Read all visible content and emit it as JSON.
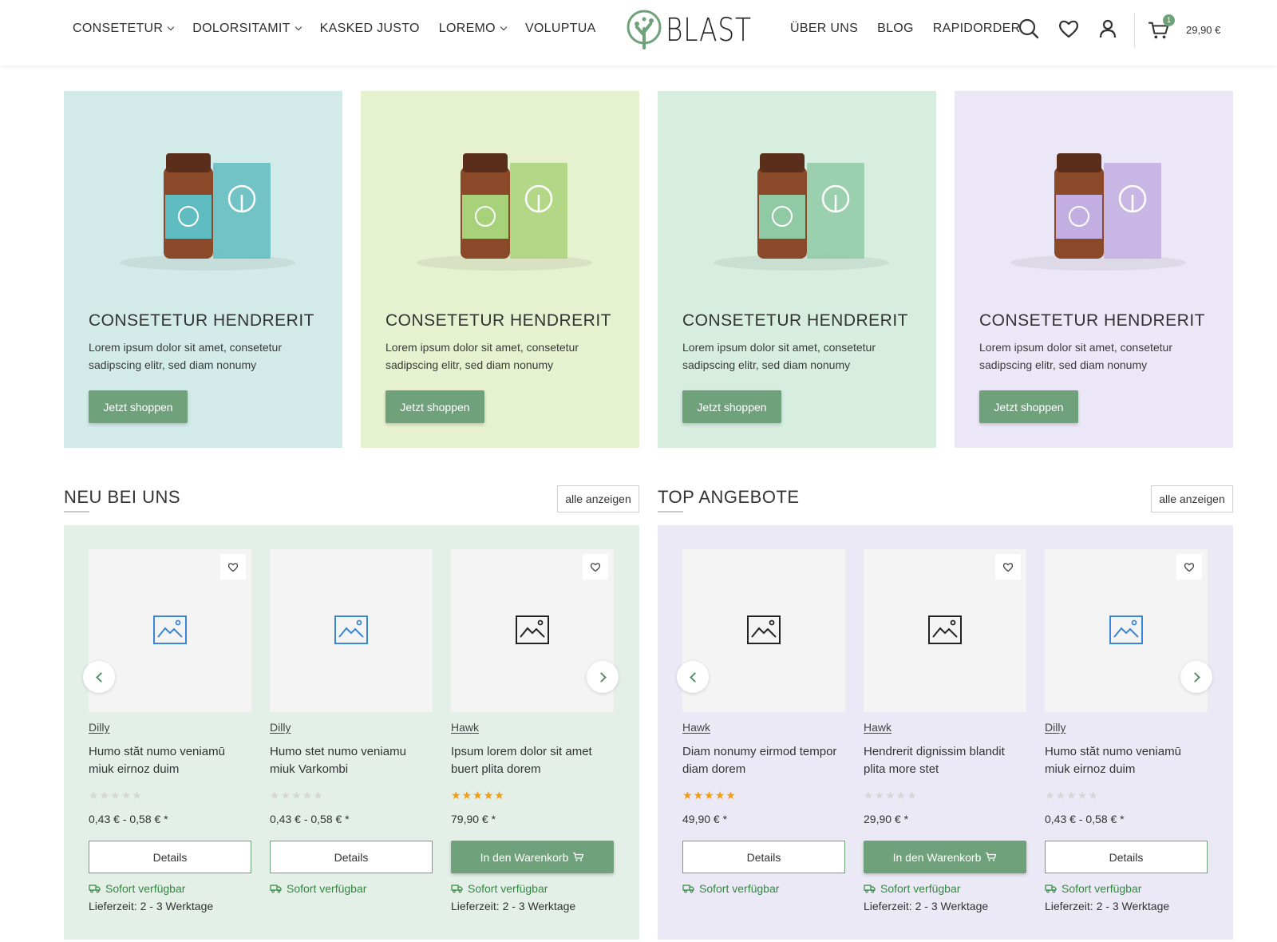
{
  "header": {
    "nav_left": [
      {
        "label": "CONSETETUR",
        "has_dropdown": true
      },
      {
        "label": "DOLORSITAMIT",
        "has_dropdown": true
      },
      {
        "label": "KASKED JUSTO",
        "has_dropdown": false
      },
      {
        "label": "LOREMO",
        "has_dropdown": true
      },
      {
        "label": "VOLUPTUA",
        "has_dropdown": false
      }
    ],
    "logo_text": "BLAST",
    "nav_right": [
      {
        "label": "ÜBER UNS"
      },
      {
        "label": "BLOG"
      },
      {
        "label": "RAPIDORDER"
      }
    ],
    "icons": [
      "search-icon",
      "heart-icon",
      "user-icon",
      "cart-icon"
    ],
    "cart_count": "1",
    "cart_total": "29,90 €"
  },
  "promo_tiles": [
    {
      "title": "CONSETETUR HENDRERIT",
      "description": "Lorem ipsum dolor sit amet, consetetur sadipscing elitr, sed diam nonumy",
      "button": "Jetzt shoppen",
      "bg": "#d3ebe8",
      "product_color": "#5fbcc0"
    },
    {
      "title": "CONSETETUR HENDRERIT",
      "description": "Lorem ipsum dolor sit amet, consetetur sadipscing elitr, sed diam nonumy",
      "button": "Jetzt shoppen",
      "bg": "#e6f1cf",
      "product_color": "#a8d27a"
    },
    {
      "title": "CONSETETUR HENDRERIT",
      "description": "Lorem ipsum dolor sit amet, consetetur sadipscing elitr, sed diam nonumy",
      "button": "Jetzt shoppen",
      "bg": "#d6ede0",
      "product_color": "#8fcaa5"
    },
    {
      "title": "CONSETETUR HENDRERIT",
      "description": "Lorem ipsum dolor sit amet, consetetur sadipscing elitr, sed diam nonumy",
      "button": "Jetzt shoppen",
      "bg": "#ece7f6",
      "product_color": "#c2aee0"
    }
  ],
  "sections": [
    {
      "title": "NEU BEI UNS",
      "show_all": "alle anzeigen",
      "bg": "#e4efe7",
      "products": [
        {
          "brand": "Dilly",
          "name": "Humo stăt numo veniamū miuk eirnoz duim",
          "rating": 0,
          "price": "0,43 € - 0,58 € *",
          "action": "Details",
          "action_type": "details",
          "availability": "Sofort verfügbar",
          "delivery": "Lieferzeit: 2 - 3 Werktage",
          "wishlist": true,
          "img_icon_color": "#3a86d6"
        },
        {
          "brand": "Dilly",
          "name": "Humo stet numo veniamu miuk Varkombi",
          "rating": 0,
          "price": "0,43 € - 0,58 € *",
          "action": "Details",
          "action_type": "details",
          "availability": "Sofort verfügbar",
          "delivery": "",
          "wishlist": false,
          "img_icon_color": "#3a86d6"
        },
        {
          "brand": "Hawk",
          "name": "Ipsum lorem dolor sit amet buert plita dorem",
          "rating": 5,
          "price": "79,90 € *",
          "action": "In den Warenkorb",
          "action_type": "cart",
          "availability": "Sofort verfügbar",
          "delivery": "Lieferzeit: 2 - 3 Werktage",
          "wishlist": true,
          "img_icon_color": "#222222"
        }
      ]
    },
    {
      "title": "TOP ANGEBOTE",
      "show_all": "alle anzeigen",
      "bg": "#ece9f6",
      "products": [
        {
          "brand": "Hawk",
          "name": "Diam nonumy eirmod tempor diam dorem",
          "rating": 5,
          "price": "49,90 € *",
          "action": "Details",
          "action_type": "details",
          "availability": "Sofort verfügbar",
          "delivery": "",
          "wishlist": false,
          "img_icon_color": "#222222"
        },
        {
          "brand": "Hawk",
          "name": "Hendrerit dignissim blandit plita more stet",
          "rating": 0,
          "price": "29,90 € *",
          "action": "In den Warenkorb",
          "action_type": "cart",
          "availability": "Sofort verfügbar",
          "delivery": "Lieferzeit: 2 - 3 Werktage",
          "wishlist": true,
          "img_icon_color": "#222222"
        },
        {
          "brand": "Dilly",
          "name": "Humo stăt numo veniamū miuk eirnoz duim",
          "rating": 0,
          "price": "0,43 € - 0,58 € *",
          "action": "Details",
          "action_type": "details",
          "availability": "Sofort verfügbar",
          "delivery": "Lieferzeit: 2 - 3 Werktage",
          "wishlist": true,
          "img_icon_color": "#3a86d6"
        }
      ]
    }
  ],
  "colors": {
    "accent": "#6fa27a",
    "available": "#2f8a3e",
    "star_on": "#f39c12",
    "star_off": "#d6d6d6"
  }
}
